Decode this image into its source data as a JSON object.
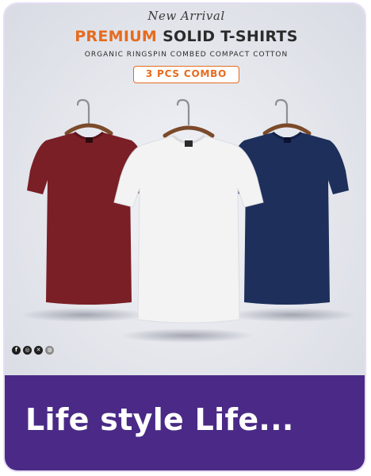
{
  "banner": {
    "script_title": "New Arrival",
    "headline_accent": "PREMIUM",
    "headline_main": "SOLID T-SHIRTS",
    "subline": "ORGANIC RINGSPIN COMBED COMPACT COTTON",
    "combo": "3 PCS COMBO"
  },
  "shirts": [
    {
      "color": "#7a1f26",
      "tag": "XL"
    },
    {
      "color": "#f3f3f3",
      "tag": "XL"
    },
    {
      "color": "#1e2f5c",
      "tag": "XL"
    }
  ],
  "social_icons": [
    {
      "name": "facebook-icon",
      "glyph": "f",
      "color": "#1f1f1f"
    },
    {
      "name": "instagram-icon",
      "glyph": "◎",
      "color": "#1f1f1f"
    },
    {
      "name": "x-icon",
      "glyph": "✕",
      "color": "#1f1f1f"
    },
    {
      "name": "website-icon",
      "glyph": "◍",
      "color": "#8a8a8a"
    }
  ],
  "colors": {
    "accent": "#e66b1e",
    "caption_bg": "#4a2a86",
    "card_border": "#e6ddf3"
  },
  "caption": {
    "title": "Life style Life..."
  }
}
